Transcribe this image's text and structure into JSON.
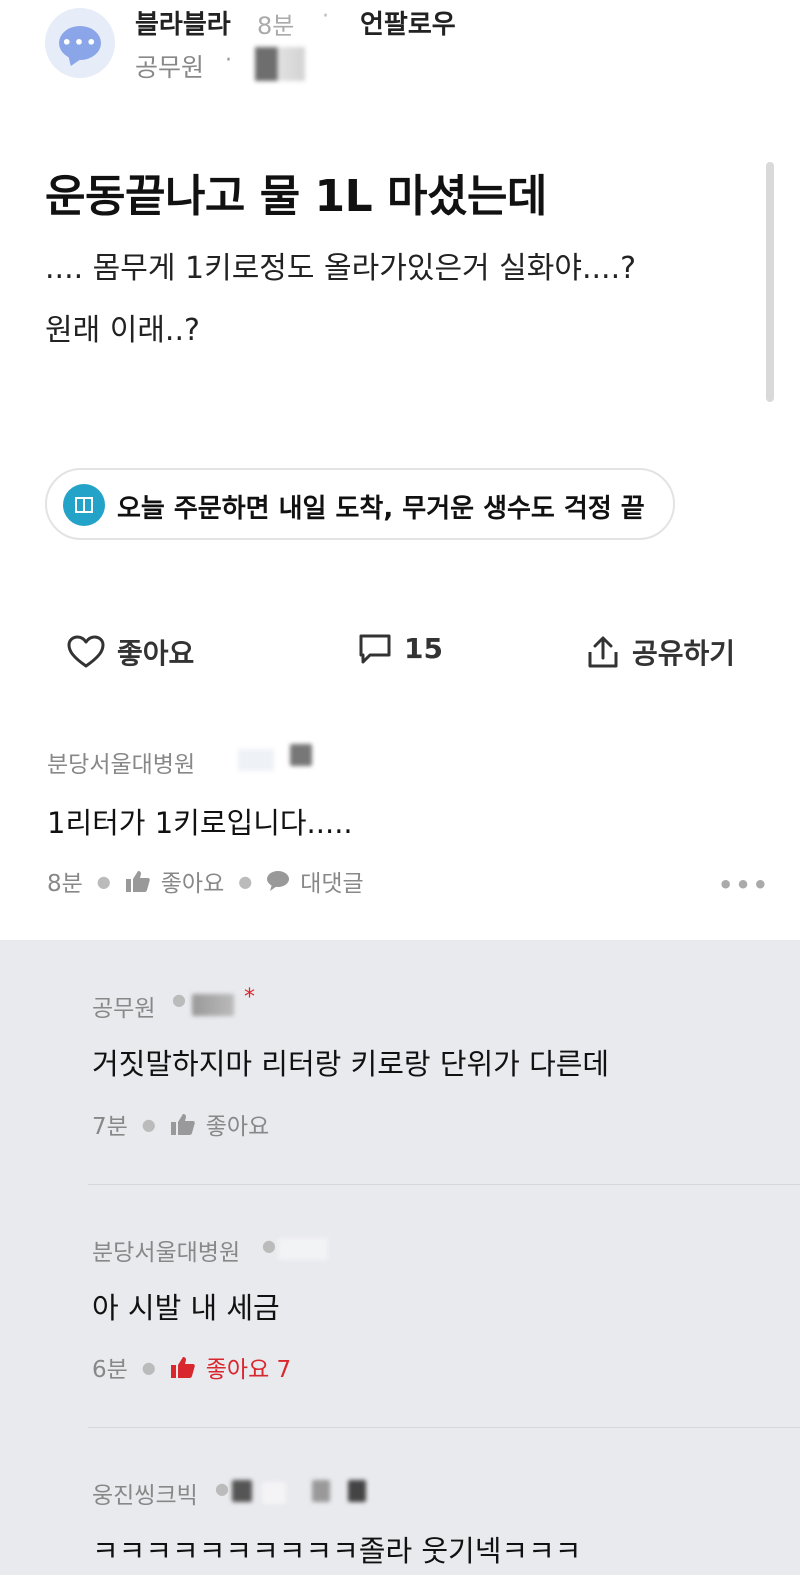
{
  "post": {
    "author": "블라블라",
    "time": "8분",
    "separator": "·",
    "unfollow": "언팔로우",
    "job": "공무원",
    "title": "운동끝나고 물 1L 마셨는데",
    "body_line1": ".... 몸무게 1키로정도 올라가있은거 실화야....?",
    "body_line2": "원래 이래..?"
  },
  "ad": {
    "text": "오늘 주문하면 내일 도착, 무거운 생수도 걱정 끝"
  },
  "actions": {
    "like": "좋아요",
    "comments": "15",
    "share": "공유하기"
  },
  "comments": [
    {
      "author": "분당서울대병원",
      "text": "1리터가 1키로입니다.....",
      "time": "8분",
      "like": "좋아요",
      "reply": "대댓글",
      "more": "•••"
    }
  ],
  "replies": [
    {
      "author": "공무원",
      "marker": "*",
      "text": "거짓말하지마 리터랑 키로랑 단위가 다른데",
      "time": "7분",
      "like": "좋아요"
    },
    {
      "author": "분당서울대병원",
      "text": "아 시발 내 세금",
      "time": "6분",
      "like": "좋아요 7"
    },
    {
      "author": "웅진씽크빅",
      "text": "ㅋㅋㅋㅋㅋㅋㅋㅋㅋㅋ졸라 웃기넥ㅋㅋㅋ"
    }
  ],
  "colors": {
    "accent_red": "#d9272e",
    "reply_bg": "#e9eaee",
    "ad_icon": "#24a3c9"
  }
}
